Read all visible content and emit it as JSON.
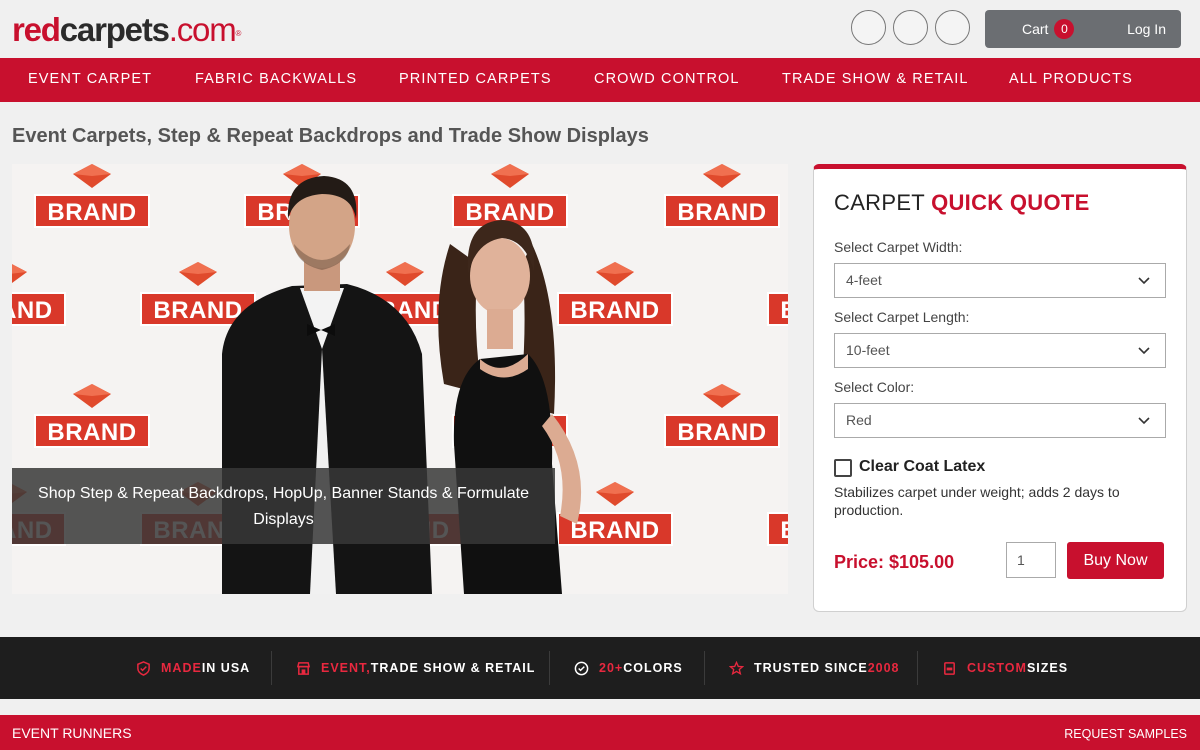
{
  "header": {
    "logo": {
      "part1": "red",
      "part2": "carpets",
      "part3": ".com",
      "mark": "®"
    },
    "icons": [
      "search-icon",
      "user-icon",
      "menu-icon"
    ],
    "cart_label": "Cart",
    "cart_count": "0",
    "login_label": "Log In"
  },
  "nav": {
    "items": [
      "EVENT CARPET",
      "FABRIC BACKWALLS",
      "PRINTED CARPETS",
      "CROWD CONTROL",
      "TRADE SHOW & RETAIL",
      "ALL PRODUCTS"
    ]
  },
  "page_title": "Event Carpets, Step & Repeat Backdrops and Trade Show Displays",
  "hero": {
    "backdrop_label": "BRAND",
    "caption": "Shop Step & Repeat Backdrops, HopUp, Banner Stands & Formulate Displays"
  },
  "quote": {
    "title_plain": "CARPET",
    "title_highlight": "QUICK QUOTE",
    "width_label": "Select Carpet Width:",
    "width_value": "4-feet",
    "length_label": "Select Carpet Length:",
    "length_value": "10-feet",
    "color_label": "Select Color:",
    "color_value": "Red",
    "option_label": "Clear Coat Latex",
    "option_desc": "Stabilizes carpet under weight; adds 2 days to production.",
    "price": "Price: $105.00",
    "quantity": "1",
    "buy_label": "Buy Now"
  },
  "features": [
    {
      "accent": "MADE",
      "rest": " IN USA",
      "icon": "shield-check-icon"
    },
    {
      "accent": "EVENT,",
      "rest": " TRADE SHOW & RETAIL",
      "icon": "store-icon"
    },
    {
      "accent": "20+",
      "rest": " COLORS",
      "icon": "check-circle-icon"
    },
    {
      "pre": "TRUSTED SINCE ",
      "accent": "2008",
      "icon": "star-icon"
    },
    {
      "accent": "CUSTOM",
      "rest": " SIZES",
      "icon": "ruler-icon"
    }
  ],
  "bottom_bar": {
    "left": "EVENT RUNNERS",
    "right": "REQUEST SAMPLES"
  },
  "colors": {
    "brand_red": "#c8102e",
    "dark_bar": "#1e1e1e",
    "account_gray": "#6b6e72"
  }
}
